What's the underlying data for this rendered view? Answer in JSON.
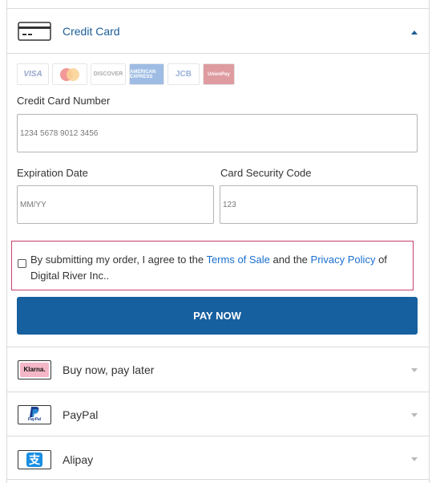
{
  "methods": {
    "credit_card": {
      "label": "Credit Card",
      "icon": "credit-card-icon",
      "expanded": true
    },
    "klarna": {
      "label": "Buy now, pay later",
      "icon": "klarna-logo",
      "logo_text": "Klarna."
    },
    "paypal": {
      "label": "PayPal",
      "icon": "paypal-logo",
      "logo_text": "PayPal"
    },
    "alipay": {
      "label": "Alipay",
      "icon": "alipay-logo",
      "logo_text": "支"
    }
  },
  "brands": [
    "VISA",
    "mastercard",
    "DISCOVER",
    "AMERICAN EXPRESS",
    "JCB",
    "UnionPay"
  ],
  "form": {
    "card_number": {
      "label": "Credit Card Number",
      "placeholder": "1234 5678 9012 3456"
    },
    "expiration": {
      "label": "Expiration Date",
      "placeholder": "MM/YY"
    },
    "security": {
      "label": "Card Security Code",
      "placeholder": "123"
    }
  },
  "consent": {
    "checked": false,
    "text_1": "By submitting my order, I agree to the ",
    "terms_link": "Terms of Sale",
    "text_2": " and the ",
    "privacy_link": "Privacy Policy",
    "text_3": " of Digital River Inc.."
  },
  "pay_button": {
    "label": "PAY NOW"
  },
  "colors": {
    "primary": "#17609f",
    "link": "#1b6fd0",
    "consent_border": "#c7426a",
    "klarna": "#f4b7c8"
  }
}
